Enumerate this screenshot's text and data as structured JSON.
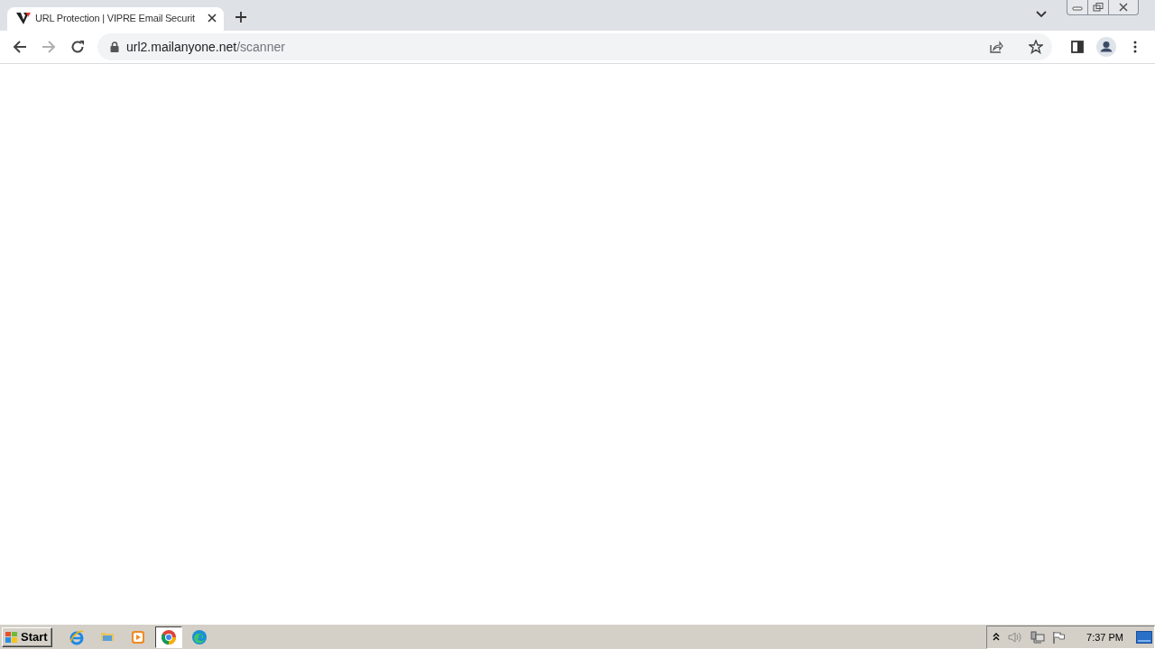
{
  "tabs": [
    {
      "title": "URL Protection | VIPRE Email Securit",
      "selected": true
    }
  ],
  "toolbar": {
    "nav": [
      {
        "kind": "back",
        "disabled": false
      },
      {
        "kind": "forward",
        "disabled": true
      },
      {
        "kind": "reload",
        "disabled": false
      }
    ],
    "address": {
      "host": "url2.mailanyone.net",
      "path": "/scanner"
    }
  },
  "taskbar": {
    "start": "Start",
    "apps": [
      {
        "kind": "ie",
        "selected": false
      },
      {
        "kind": "folder",
        "selected": false
      },
      {
        "kind": "media",
        "selected": false
      },
      {
        "kind": "chrome",
        "selected": true
      },
      {
        "kind": "edge",
        "selected": false
      }
    ],
    "clock": "7:37 PM"
  }
}
